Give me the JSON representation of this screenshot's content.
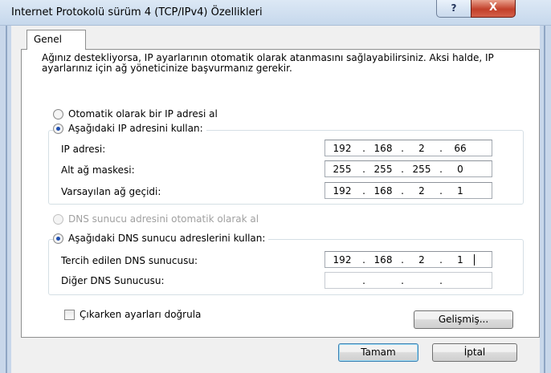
{
  "window": {
    "title": "Internet Protokolü sürüm 4 (TCP/IPv4) Özellikleri",
    "help_label": "?",
    "close_label": "X"
  },
  "tabs": [
    {
      "label": "Genel",
      "active": true
    }
  ],
  "general": {
    "description": "Ağınız destekliyorsa, IP ayarlarının otomatik olarak atanmasını sağlayabilirsiniz. Aksi halde, IP ayarlarınız için ağ yöneticinize başvurmanız gerekir.",
    "ip_auto_label": "Otomatik olarak bir IP adresi al",
    "ip_manual_label": "Aşağıdaki IP adresini kullan:",
    "ip_mode": "manual",
    "fields": {
      "ip_address": {
        "label": "IP adresi:",
        "octets": [
          "192",
          "168",
          "2",
          "66"
        ]
      },
      "subnet_mask": {
        "label": "Alt ağ maskesi:",
        "octets": [
          "255",
          "255",
          "255",
          "0"
        ]
      },
      "default_gateway": {
        "label": "Varsayılan ağ geçidi:",
        "octets": [
          "192",
          "168",
          "2",
          "1"
        ]
      }
    },
    "dns_auto_label": "DNS sunucu adresini otomatik olarak al",
    "dns_manual_label": "Aşağıdaki DNS sunucu adreslerini kullan:",
    "dns_mode": "manual",
    "dns_fields": {
      "preferred": {
        "label": "Tercih edilen DNS sunucusu:",
        "octets": [
          "192",
          "168",
          "2",
          "1"
        ]
      },
      "alternate": {
        "label": "Diğer DNS Sunucusu:",
        "octets": [
          "",
          "",
          "",
          ""
        ]
      }
    },
    "validate_label": "Çıkarken ayarları doğrula",
    "validate_checked": false,
    "advanced_label": "Gelişmiş..."
  },
  "footer": {
    "ok_label": "Tamam",
    "cancel_label": "İptal"
  }
}
